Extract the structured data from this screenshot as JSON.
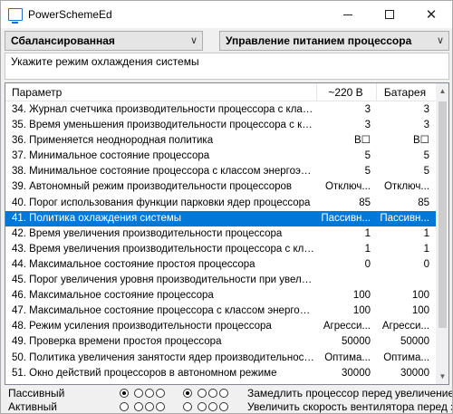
{
  "window": {
    "title": "PowerSchemeEd"
  },
  "combos": {
    "scheme": "Сбалансированная",
    "group": "Управление питанием процессора"
  },
  "description": "Укажите режим охлаждения системы",
  "table": {
    "headers": {
      "param": "Параметр",
      "ac": "~220 В",
      "dc": "Батарея"
    },
    "rows": [
      {
        "name": "34. Журнал счетчика производительности процессора с класс...",
        "ac": "3",
        "dc": "3"
      },
      {
        "name": "35. Время уменьшения производительности процессора с класс...",
        "ac": "3",
        "dc": "3"
      },
      {
        "name": "36. Применяется неоднородная политика",
        "ac": "B☐",
        "dc": "B☐"
      },
      {
        "name": "37. Минимальное состояние процессора",
        "ac": "5",
        "dc": "5"
      },
      {
        "name": "38. Минимальное состояние процессора с классом энергоэфф...",
        "ac": "5",
        "dc": "5"
      },
      {
        "name": "39. Автономный режим производительности процессоров",
        "ac": "Отключ...",
        "dc": "Отключ..."
      },
      {
        "name": "40. Порог использования функции парковки ядер процессора",
        "ac": "85",
        "dc": "85"
      },
      {
        "name": "41. Политика охлаждения системы",
        "ac": "Пассивн...",
        "dc": "Пассивн..."
      },
      {
        "name": "42. Время увеличения производительности процессора",
        "ac": "1",
        "dc": "1"
      },
      {
        "name": "43. Время увеличения производительности процессора с класс...",
        "ac": "1",
        "dc": "1"
      },
      {
        "name": "44. Максимальное состояние простоя процессора",
        "ac": "0",
        "dc": "0"
      },
      {
        "name": "45. Порог увеличения уровня производительности при увелич...",
        "ac": "",
        "dc": ""
      },
      {
        "name": "46. Максимальное состояние процессора",
        "ac": "100",
        "dc": "100"
      },
      {
        "name": "47. Максимальное состояние процессора с классом энергоэф...",
        "ac": "100",
        "dc": "100"
      },
      {
        "name": "48. Режим усиления производительности процессора",
        "ac": "Агресси...",
        "dc": "Агресси..."
      },
      {
        "name": "49. Проверка времени простоя процессора",
        "ac": "50000",
        "dc": "50000"
      },
      {
        "name": "50. Политика увеличения занятости ядер производительности ...",
        "ac": "Оптима...",
        "dc": "Оптима..."
      },
      {
        "name": "51. Окно действий процессоров в автономном режиме",
        "ac": "30000",
        "dc": "30000"
      }
    ],
    "selected_index": 7
  },
  "modes": [
    {
      "label": "Пассивный",
      "hint": "Замедлить процессор перед увеличением"
    },
    {
      "label": "Активный",
      "hint": "Увеличить скорость вентилятора перед за"
    }
  ],
  "colors": {
    "selection": "#0078d7",
    "background": "#f0f0f0"
  }
}
